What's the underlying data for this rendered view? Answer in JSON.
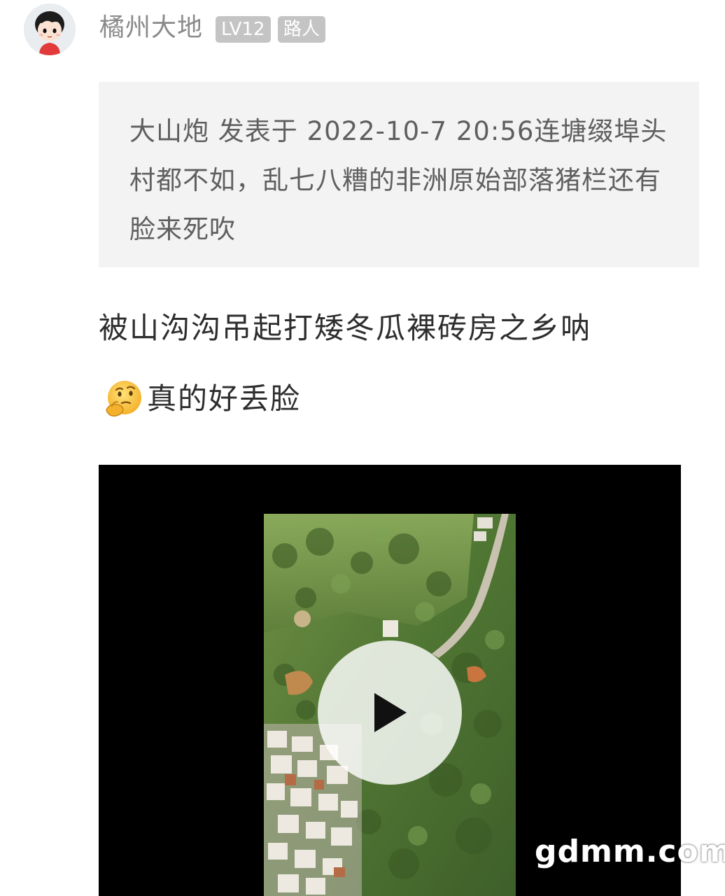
{
  "header": {
    "username": "橘州大地",
    "level_badge": "LV12",
    "role_badge": "路人",
    "avatar_icon": "cartoon-boy-avatar-icon"
  },
  "quote": {
    "text": "大山炮 发表于 2022-10-7 20:56连塘缀埠头村都不如，乱七八糟的非洲原始部落猪栏还有脸来死吹"
  },
  "post": {
    "line1": "被山沟沟吊起打矮冬瓜裸砖房之乡呐",
    "line2": "真的好丢脸",
    "emoji_icon": "thinking-face-emoji-icon"
  },
  "video": {
    "play_icon": "play-icon",
    "thumbnail": "aerial-village-hillside-thumbnail"
  },
  "watermark": "gdmm.com",
  "colors": {
    "username": "#8a8a8a",
    "badge_bg": "#c4c4c4",
    "quote_bg": "#f3f3f3",
    "quote_text": "#5f5f5f",
    "body_text": "#2e2e2e"
  }
}
